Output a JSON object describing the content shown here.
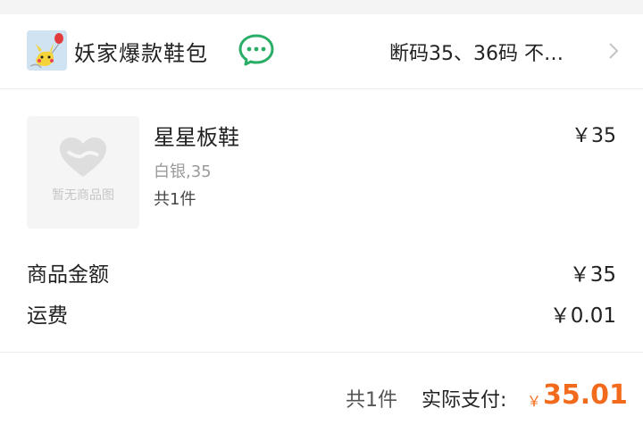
{
  "shop": {
    "name": "妖家爆款鞋包",
    "note": "断码35、36码 不…"
  },
  "product": {
    "title": "星星板鞋",
    "price": "￥35",
    "sku": "白银,35",
    "qty": "共1件",
    "placeholder_text": "暂无商品图"
  },
  "summary": {
    "goods_label": "商品金额",
    "goods_value": "￥35",
    "shipping_label": "运费",
    "shipping_value": "￥0.01"
  },
  "footer": {
    "count": "共1件",
    "pay_label": "实际支付:",
    "currency": "￥",
    "total": "35.01"
  },
  "colors": {
    "accent": "#f26b1d",
    "wechat_green": "#2aae67"
  },
  "icons": {
    "chat": "wechat-chat-icon",
    "chevron": "chevron-right-icon",
    "placeholder": "heart-placeholder-icon"
  }
}
